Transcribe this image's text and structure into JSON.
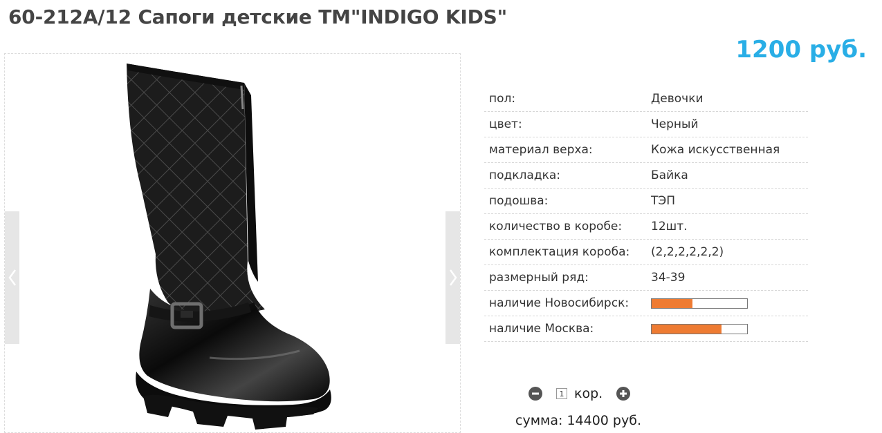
{
  "product": {
    "title": "60-212A/12 Сапоги детские ТМ\"INDIGO KIDS\"",
    "price": "1200 руб."
  },
  "gallery": {
    "image": "black-quilted-boot-icon"
  },
  "specs": [
    {
      "label": "пол:",
      "value": "Девочки"
    },
    {
      "label": "цвет:",
      "value": "Черный"
    },
    {
      "label": "материал верха:",
      "value": "Кожа искусственная"
    },
    {
      "label": "подкладка:",
      "value": "Байка"
    },
    {
      "label": "подошва:",
      "value": "ТЭП"
    },
    {
      "label": "количество в коробе:",
      "value": "12шт."
    },
    {
      "label": "комплектация короба:",
      "value": "(2,2,2,2,2,2)"
    },
    {
      "label": "размерный ряд:",
      "value": "34-39"
    }
  ],
  "stock": [
    {
      "label": "наличие Новосибирск:",
      "level": 0.43
    },
    {
      "label": "наличие Москва:",
      "level": 0.73
    }
  ],
  "order": {
    "qty_value": "1",
    "unit": "кор.",
    "sum": "сумма: 14400 руб."
  },
  "colors": {
    "price": "#29aee6",
    "stock_fill": "#ee7b32"
  }
}
